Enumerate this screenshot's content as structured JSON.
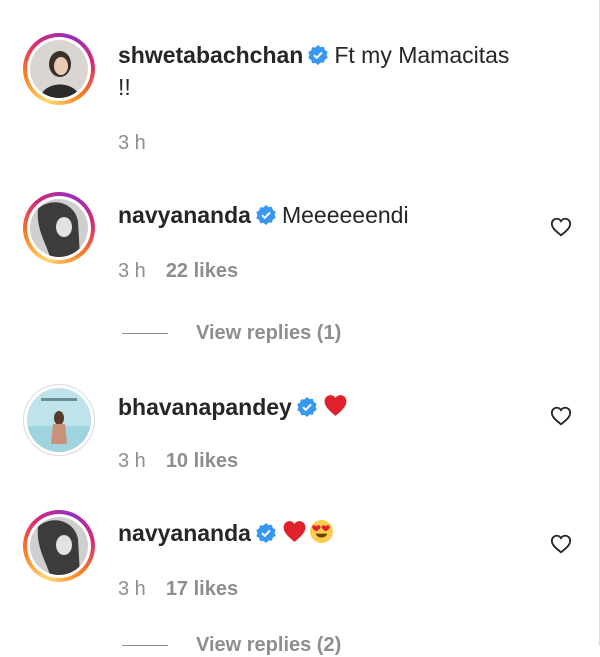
{
  "comments": [
    {
      "username": "shwetabachchan",
      "text_line1": "Ft my Mamacitas",
      "text_line2": "!!",
      "time": "3 h",
      "likes": "",
      "avatar_story_ring": true,
      "has_like_button": false
    },
    {
      "username": "navyananda",
      "text": "Meeeeeendi",
      "time": "3 h",
      "likes": "22 likes",
      "avatar_story_ring": true,
      "has_like_button": true,
      "view_replies": "View replies (1)"
    },
    {
      "username": "bhavanapandey",
      "text": "",
      "emojis": [
        "red-heart"
      ],
      "time": "3 h",
      "likes": "10 likes",
      "avatar_story_ring": false,
      "has_like_button": true
    },
    {
      "username": "navyananda",
      "text": "",
      "emojis": [
        "red-heart",
        "heart-eyes-face"
      ],
      "time": "3 h",
      "likes": "17 likes",
      "avatar_story_ring": true,
      "has_like_button": true,
      "view_replies": "View replies (2)"
    }
  ],
  "icons": {
    "verified": "verified-badge-icon",
    "like": "heart-outline-icon"
  },
  "colors": {
    "verified_blue": "#3897f0",
    "meta_gray": "#8e8e8e",
    "heart_red": "#ed4956",
    "text": "#262626"
  }
}
